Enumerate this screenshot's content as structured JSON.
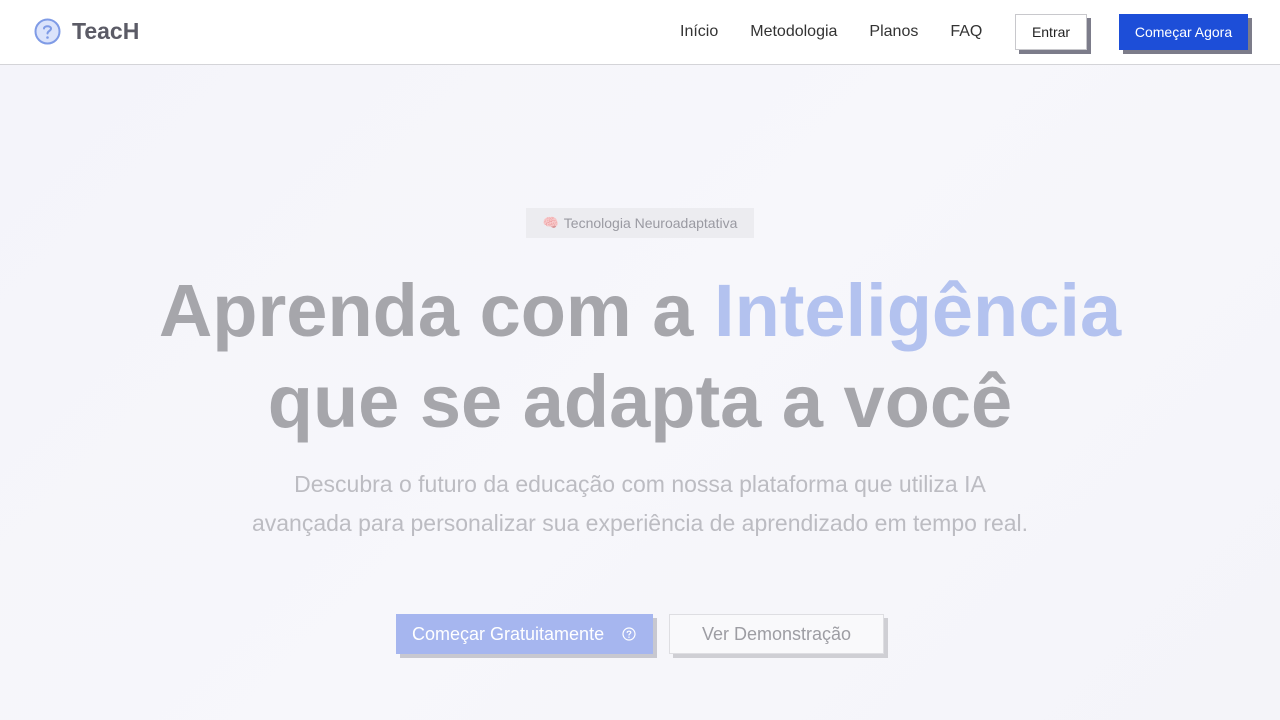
{
  "brand": {
    "name": "TeacH",
    "logo_icon": "question-circle-icon",
    "accent": "#1d4ed8"
  },
  "nav": {
    "links": [
      "Início",
      "Metodologia",
      "Planos",
      "FAQ"
    ],
    "login_label": "Entrar",
    "start_label": "Começar Agora"
  },
  "hero": {
    "badge_icon": "🧠",
    "badge_text": "Tecnologia Neuroadaptativa",
    "title_part1": "Aprenda com a ",
    "title_highlight": "Inteligência",
    "title_part2": "que se adapta a você",
    "subtitle": "Descubra o futuro da educação com nossa plataforma que utiliza IA avançada para personalizar sua experiência de aprendizado em tempo real.",
    "cta_primary": "Começar Gratuitamente",
    "cta_primary_icon": "question-circle-icon",
    "cta_secondary": "Ver Demonstração"
  }
}
